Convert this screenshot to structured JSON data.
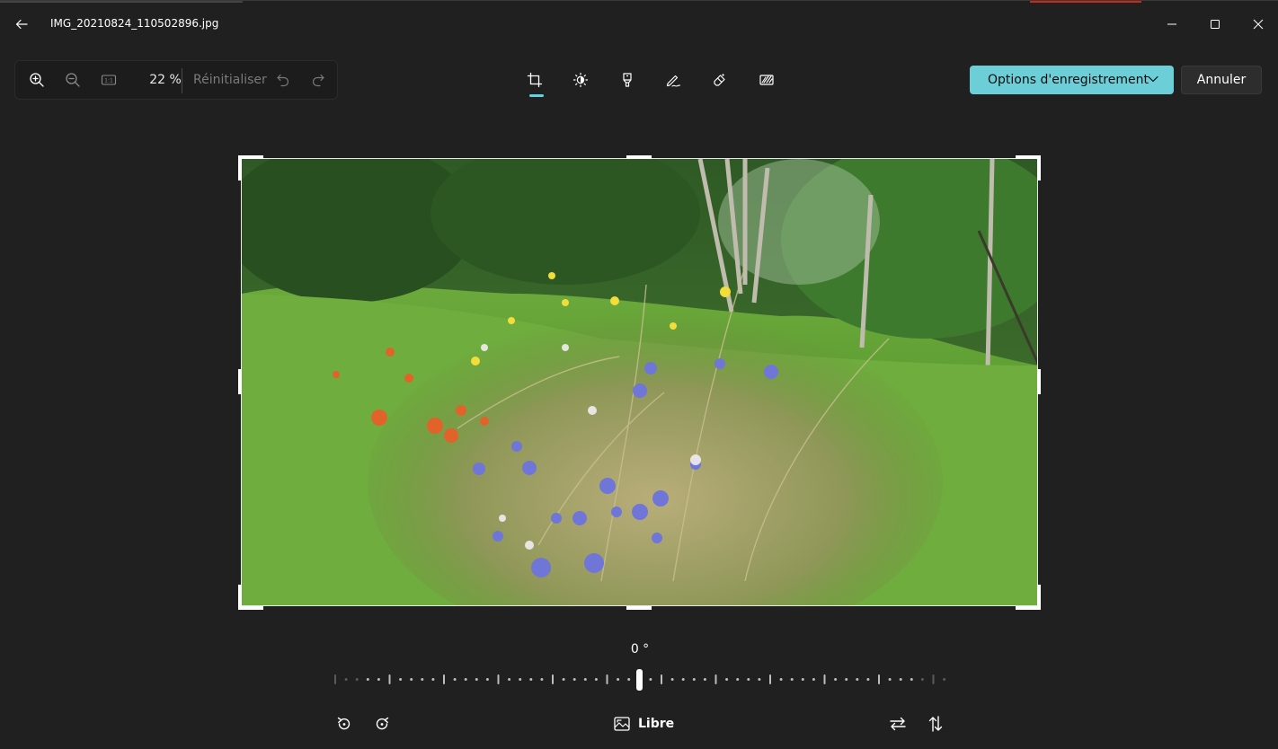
{
  "window": {
    "title": "IMG_20210824_110502896.jpg",
    "accent": "#6ccfd8",
    "background": "#202020"
  },
  "zoom": {
    "value": "22 %",
    "reset_label": "Réinitialiser",
    "icons": [
      "zoom-in-icon",
      "zoom-out-icon",
      "actual-size-icon",
      "undo-icon",
      "redo-icon"
    ]
  },
  "tools": {
    "items": [
      "crop-icon",
      "adjustment-icon",
      "filter-icon",
      "markup-icon",
      "erase-icon",
      "background-blur-icon"
    ],
    "active": "crop-icon"
  },
  "actions": {
    "save_label": "Options d'enregistrement",
    "cancel_label": "Annuler"
  },
  "straighten": {
    "angle_label": "0 °",
    "angle_value": 0
  },
  "bottom": {
    "ratio_label": "Libre",
    "icons": [
      "rotate-left-icon",
      "rotate-right-icon",
      "aspect-ratio-icon",
      "flip-horizontal-icon",
      "flip-vertical-icon"
    ]
  }
}
